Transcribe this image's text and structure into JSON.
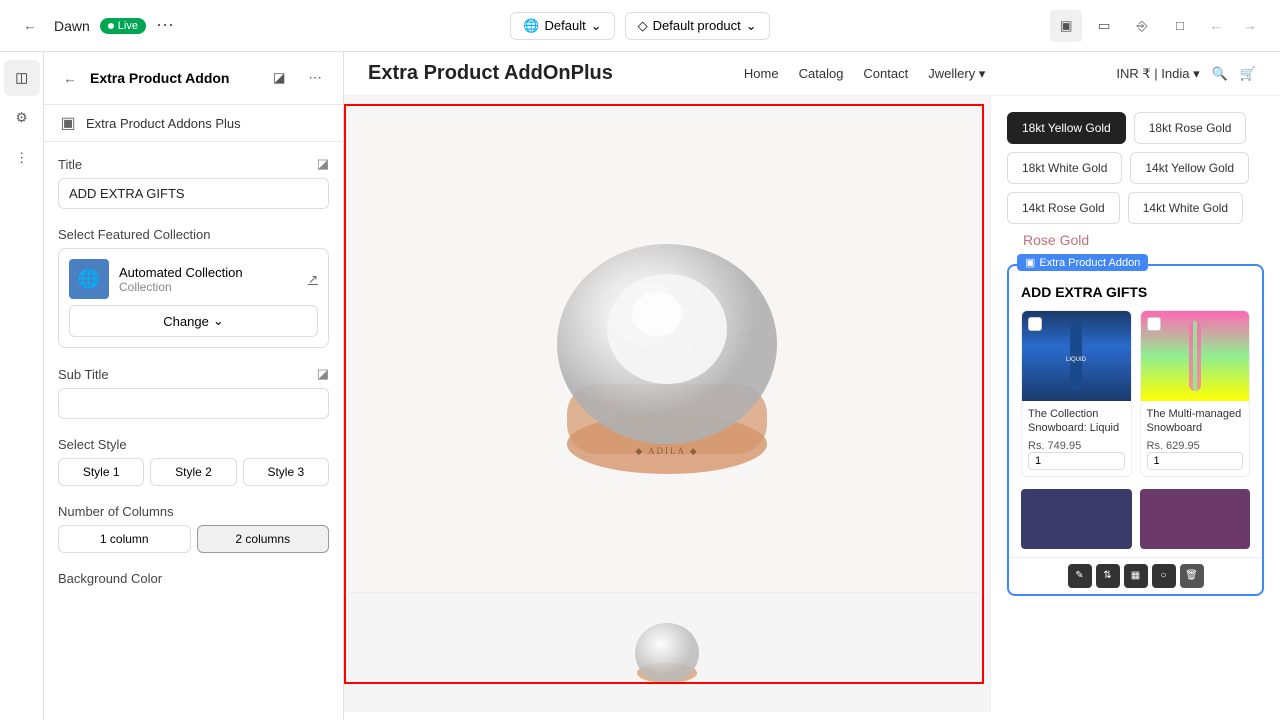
{
  "topbar": {
    "store_name": "Dawn",
    "live_label": "Live",
    "more_icon": "⋯",
    "default_theme": "Default",
    "default_product": "Default product",
    "undo_label": "←",
    "redo_label": "→"
  },
  "sidebar_icons": [
    {
      "name": "sections-icon",
      "symbol": "⊞",
      "active": true
    },
    {
      "name": "settings-icon",
      "symbol": "⚙"
    },
    {
      "name": "apps-icon",
      "symbol": "⋮⋮"
    }
  ],
  "left_panel": {
    "title": "Extra Product Addon",
    "sub_item": "Extra Product Addons Plus",
    "title_label": "Title",
    "title_value": "ADD EXTRA GIFTS",
    "select_collection_label": "Select Featured Collection",
    "collection_name": "Automated Collection",
    "collection_type": "Collection",
    "change_btn": "Change",
    "subtitle_label": "Sub Title",
    "subtitle_placeholder": "",
    "select_style_label": "Select Style",
    "styles": [
      "Style 1",
      "Style 2",
      "Style 3"
    ],
    "columns_label": "Number of Columns",
    "columns": [
      "1 column",
      "2 columns"
    ],
    "background_color_label": "Background Color"
  },
  "store": {
    "logo": "Extra Product AddOnPlus",
    "nav": [
      "Home",
      "Catalog",
      "Contact",
      "Jwellery ▾"
    ],
    "currency": "INR ₹ | India ▾"
  },
  "gold_options": [
    {
      "label": "18kt Yellow Gold",
      "active": true
    },
    {
      "label": "18kt Rose Gold"
    },
    {
      "label": "18kt White Gold"
    },
    {
      "label": "14kt Yellow Gold"
    },
    {
      "label": "14kt Rose Gold"
    },
    {
      "label": "14kt White Gold"
    }
  ],
  "rose_gold_text": "Rose Gold",
  "addon_widget": {
    "badge": "Extra Product Addon",
    "title": "ADD EXTRA GIFTS",
    "products": [
      {
        "name": "The Collection Snowboard: Liquid",
        "price": "Rs. 749.95",
        "qty": "1"
      },
      {
        "name": "The Multi-managed Snowboard",
        "price": "Rs. 629.95",
        "qty": "1"
      }
    ]
  }
}
